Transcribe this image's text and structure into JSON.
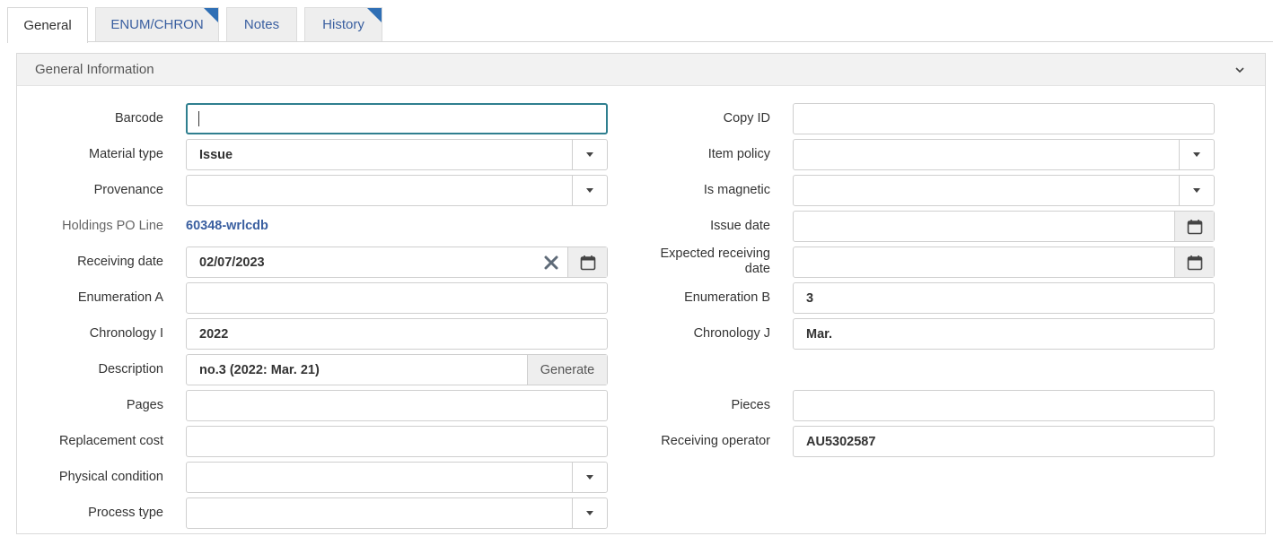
{
  "tabs": [
    {
      "label": "General",
      "active": true,
      "marked": false
    },
    {
      "label": "ENUM/CHRON",
      "active": false,
      "marked": true
    },
    {
      "label": "Notes",
      "active": false,
      "marked": false
    },
    {
      "label": "History",
      "active": false,
      "marked": true
    }
  ],
  "panel": {
    "title": "General Information"
  },
  "left": {
    "barcode": {
      "label": "Barcode",
      "value": ""
    },
    "material_type": {
      "label": "Material type",
      "value": "Issue"
    },
    "provenance": {
      "label": "Provenance",
      "value": ""
    },
    "holdings_po_line": {
      "label": "Holdings PO Line",
      "value": "60348-wrlcdb"
    },
    "receiving_date": {
      "label": "Receiving date",
      "value": "02/07/2023"
    },
    "enumeration_a": {
      "label": "Enumeration A",
      "value": ""
    },
    "chronology_i": {
      "label": "Chronology I",
      "value": "2022"
    },
    "description": {
      "label": "Description",
      "value": "no.3 (2022: Mar. 21)",
      "button": "Generate"
    },
    "pages": {
      "label": "Pages",
      "value": ""
    },
    "replacement_cost": {
      "label": "Replacement cost",
      "value": ""
    },
    "physical_condition": {
      "label": "Physical condition",
      "value": ""
    },
    "process_type": {
      "label": "Process type",
      "value": ""
    }
  },
  "right": {
    "copy_id": {
      "label": "Copy ID",
      "value": ""
    },
    "item_policy": {
      "label": "Item policy",
      "value": ""
    },
    "is_magnetic": {
      "label": "Is magnetic",
      "value": ""
    },
    "issue_date": {
      "label": "Issue date",
      "value": ""
    },
    "expected_receiving_date": {
      "label_line1": "Expected receiving",
      "label_line2": "date",
      "value": ""
    },
    "enumeration_b": {
      "label": "Enumeration B",
      "value": "3"
    },
    "chronology_j": {
      "label": "Chronology J",
      "value": "Mar."
    },
    "pieces": {
      "label": "Pieces",
      "value": ""
    },
    "receiving_operator": {
      "label": "Receiving operator",
      "value": "AU5302587"
    }
  },
  "icons": {
    "dropdown": "caret-down-icon",
    "calendar": "calendar-icon",
    "clear": "clear-x-icon",
    "collapse": "chevron-down-icon",
    "tab_marker": "corner-marker-icon"
  },
  "colors": {
    "link": "#3a5fa0",
    "focus_border": "#2f7f8f",
    "tab_marker": "#2f6fb5"
  }
}
